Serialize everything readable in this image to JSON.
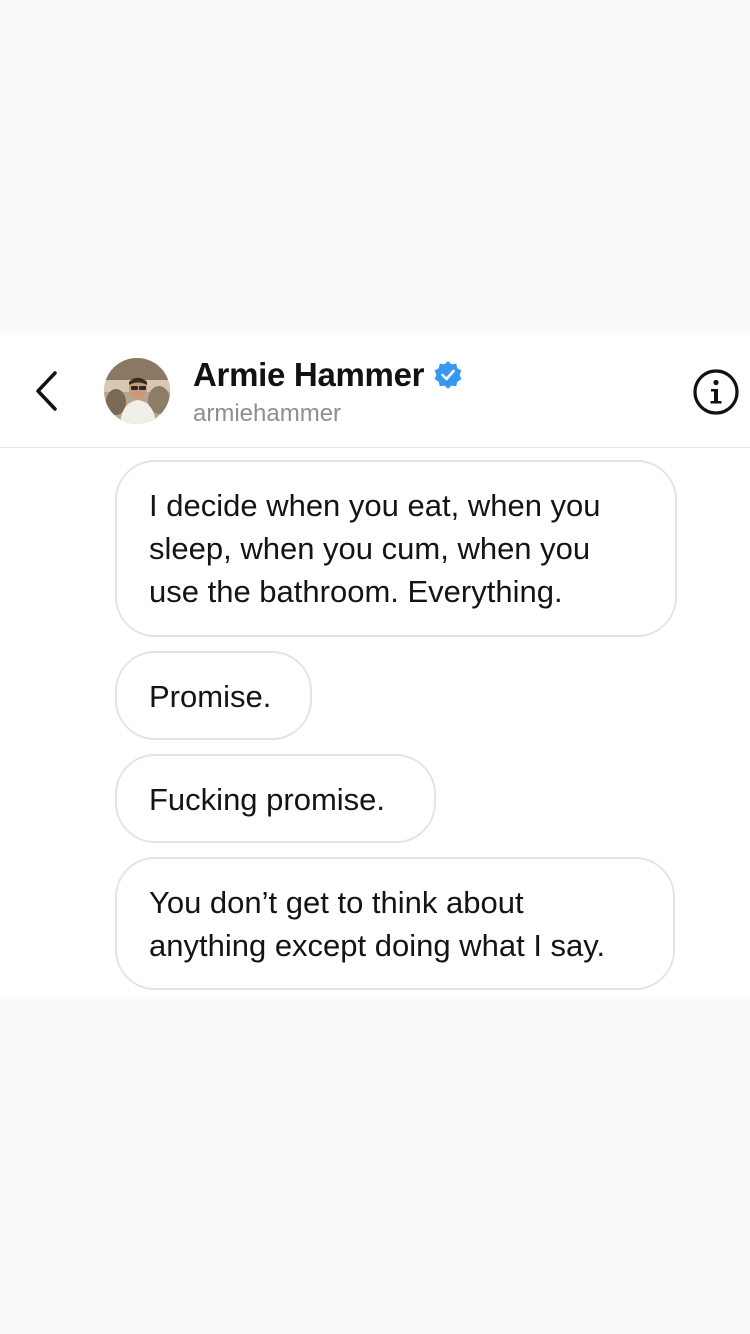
{
  "header": {
    "display_name": "Armie Hammer",
    "username": "armiehammer",
    "verified": true,
    "back_icon": "chevron-left-icon",
    "info_icon": "info-icon",
    "badge_color": "#3897f0"
  },
  "messages": [
    {
      "text": "I decide when you eat, when you sleep, when you cum, when you use the bathroom. Everything."
    },
    {
      "text": "Promise."
    },
    {
      "text": "Fucking promise."
    },
    {
      "text": "You don’t get to think about anything except doing what I say."
    }
  ]
}
